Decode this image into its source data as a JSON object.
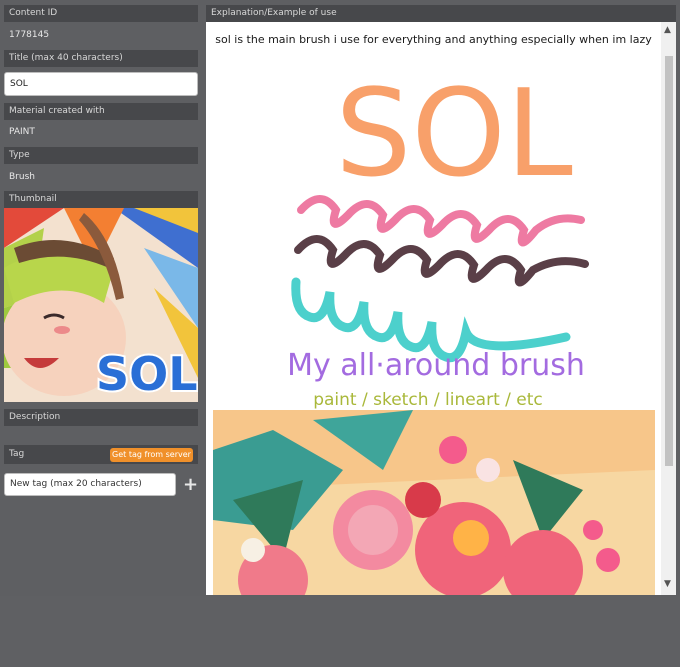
{
  "content_id": {
    "label": "Content ID",
    "value": "1778145"
  },
  "title": {
    "label": "Title (max 40 characters)",
    "value": "SOL"
  },
  "material": {
    "label": "Material created with",
    "value": "PAINT"
  },
  "type": {
    "label": "Type",
    "value": "Brush"
  },
  "thumbnail": {
    "label": "Thumbnail",
    "logo_text": "SOL"
  },
  "description": {
    "label": "Description"
  },
  "tag": {
    "label": "Tag",
    "get_button": "Get tag from server",
    "new_placeholder": "New tag (max 20 characters)",
    "add_icon": "plus-icon"
  },
  "explanation": {
    "label": "Explanation/Example of use",
    "caption": "sol is the main brush i use for everything and anything especially when im lazy",
    "art_title": "SOL",
    "art_line1": "My all·around brush",
    "art_line2": "paint / sketch / lineart / etc"
  },
  "colors": {
    "panel_bg": "#5e5f62",
    "header_bg": "#47484b",
    "accent": "#f0902a",
    "sol_orange": "#f8a06a",
    "pink": "#ee7aa2",
    "plum": "#5a3f47",
    "teal": "#4cd0cc",
    "purple": "#a36be0",
    "olive": "#a9b83a"
  }
}
